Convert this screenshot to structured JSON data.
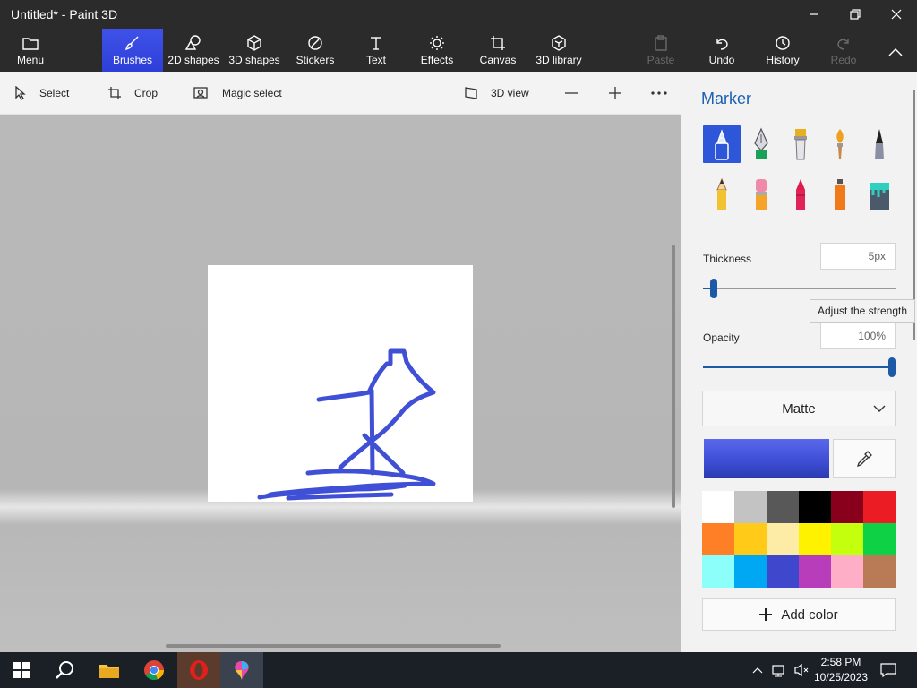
{
  "window": {
    "title": "Untitled* - Paint 3D"
  },
  "ribbon": {
    "menu": "Menu",
    "brushes": "Brushes",
    "shapes2d": "2D shapes",
    "shapes3d": "3D shapes",
    "stickers": "Stickers",
    "text": "Text",
    "effects": "Effects",
    "canvas": "Canvas",
    "library3d": "3D library",
    "paste": "Paste",
    "undo": "Undo",
    "history": "History",
    "redo": "Redo"
  },
  "toolbar": {
    "select": "Select",
    "crop": "Crop",
    "magic_select": "Magic select",
    "view3d": "3D view"
  },
  "panel": {
    "title": "Marker",
    "brushes": [
      "marker",
      "calligraphy-pen",
      "oil-brush",
      "watercolor",
      "pixel-pen",
      "pencil",
      "eraser",
      "crayon",
      "spray-can",
      "fill"
    ],
    "selected_brush": "marker",
    "thickness_label": "Thickness",
    "thickness_value": "5px",
    "thickness_fraction": 0.05,
    "tooltip": "Adjust the strength",
    "opacity_label": "Opacity",
    "opacity_value": "100%",
    "opacity_fraction": 1.0,
    "finish": "Matte",
    "current_color": "#3f4fd6",
    "palette": [
      "#ffffff",
      "#c3c3c3",
      "#585858",
      "#000000",
      "#88001b",
      "#ec1c24",
      "#ff7f27",
      "#ffca18",
      "#fdeca6",
      "#fff200",
      "#c4ff0e",
      "#0ed145",
      "#8cfffb",
      "#00a8f3",
      "#3f48cc",
      "#b83dba",
      "#ffaec8",
      "#b97a56"
    ],
    "add_color": "Add color"
  },
  "taskbar": {
    "time": "2:58 PM",
    "date": "10/25/2023"
  }
}
